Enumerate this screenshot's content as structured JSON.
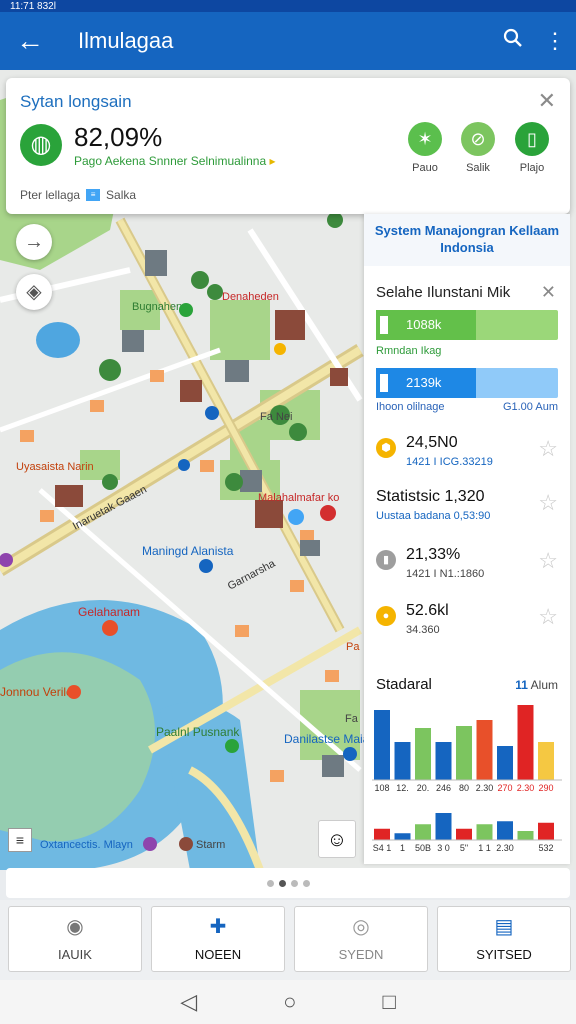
{
  "status_bar": {
    "left": "11:71 832l",
    "right": ""
  },
  "app_bar": {
    "title": "Ilmulagaa",
    "back_icon": "arrow-left-icon",
    "search_icon": "search-icon",
    "more_icon": "more-vert-icon"
  },
  "info_card": {
    "title": "Sytan longsain",
    "value": "82,09%",
    "subtitle": "Pago Aekena Snnner Selnimualinna",
    "footer_text": "Pter lellaga",
    "footer_link": "Salka",
    "actions": [
      {
        "label": "Pauo",
        "icon": "star-burst-icon",
        "color": "#5bbf4d"
      },
      {
        "label": "Salik",
        "icon": "no-entry-icon",
        "color": "#7cc55f"
      },
      {
        "label": "Plajo",
        "icon": "clipboard-icon",
        "color": "#2aa33a"
      }
    ]
  },
  "map": {
    "labels": [
      "Bugnahen",
      "Denaheden",
      "Fa Nei",
      "Uyasaista Narin",
      "Malahalmafar ko",
      "Inaruetak Gaaen",
      "Maningd Alanista",
      "Garnarsha",
      "Gelahanam",
      "Pa",
      "Jonnou Verile",
      "Paalnl Pusnank",
      "Danilastse Maian",
      "Fa",
      "Oxtancectis. Mlayn",
      "Starm"
    ]
  },
  "panel": {
    "header": "System Manajongran Kellaam Indonsia",
    "subtitle": "Selahe Ilunstani Mik",
    "bar_green": {
      "value": "1088k",
      "caption": "Rmndan Ikag",
      "fill": 0.55,
      "color": "#63c04a"
    },
    "bar_blue": {
      "value": "2139k",
      "caption": "Ihoon olilnage",
      "caption_right": "G1.00 Aum",
      "fill": 0.55,
      "color": "#1e88e5"
    },
    "stats": [
      {
        "value": "24,5N0",
        "sub": "1421 I ICG.33219",
        "icon": "hexagon-icon",
        "icon_color": "#f5b400"
      },
      {
        "value": "Statistsic 1,320",
        "sub": "Uustaa badana 0,53:90",
        "icon": "",
        "icon_color": ""
      },
      {
        "value": "21,33%",
        "sub": "1421 I N1.:1860",
        "icon": "slot-icon",
        "icon_color": "#9e9e9e"
      },
      {
        "value": "52.6kl",
        "sub": "34.360",
        "icon": "coin-icon",
        "icon_color": "#f5b400"
      }
    ]
  },
  "chart_data": {
    "type": "bar",
    "title": "Stadaral",
    "meta_number": "11",
    "meta_unit": "Alum",
    "panels": [
      {
        "values": [
          70,
          38,
          52,
          38,
          54,
          60,
          34,
          75,
          38
        ],
        "colors": [
          "#1565c0",
          "#1565c0",
          "#7cc55f",
          "#1565c0",
          "#7cc55f",
          "#e8502a",
          "#1565c0",
          "#e02424",
          "#f5c842"
        ],
        "tick_labels": [
          "108",
          "12.",
          "20.",
          "246",
          "80",
          "2.30",
          "270",
          "2.30",
          "290"
        ]
      },
      {
        "values": [
          30,
          18,
          42,
          72,
          30,
          42,
          50,
          24,
          46
        ],
        "colors": [
          "#e02424",
          "#1565c0",
          "#7cc55f",
          "#1565c0",
          "#e02424",
          "#7cc55f",
          "#1565c0",
          "#7cc55f",
          "#e02424"
        ],
        "tick_labels": [
          "S4 1",
          "1",
          "50B",
          "3 0",
          "5\"",
          "1 1",
          "2.30",
          "",
          "532"
        ]
      }
    ]
  },
  "pager": {
    "count": 4,
    "active": 1
  },
  "tabs": [
    {
      "label": "IAUIK",
      "icon": "camera-icon",
      "color": "#444",
      "icon_color": "#777"
    },
    {
      "label": "NOEEN",
      "icon": "shield-plus-icon",
      "color": "#111",
      "icon_color": "#1565c0"
    },
    {
      "label": "SYEDN",
      "icon": "search-icon",
      "color": "#888",
      "icon_color": "#999"
    },
    {
      "label": "SYITSED",
      "icon": "id-card-icon",
      "color": "#111",
      "icon_color": "#1565c0"
    }
  ],
  "nav_bar": {
    "back": "◁",
    "home": "○",
    "recent": "□"
  },
  "avatar": {
    "icon": "avatar-icon"
  },
  "layers": {
    "icon": "list-icon"
  }
}
